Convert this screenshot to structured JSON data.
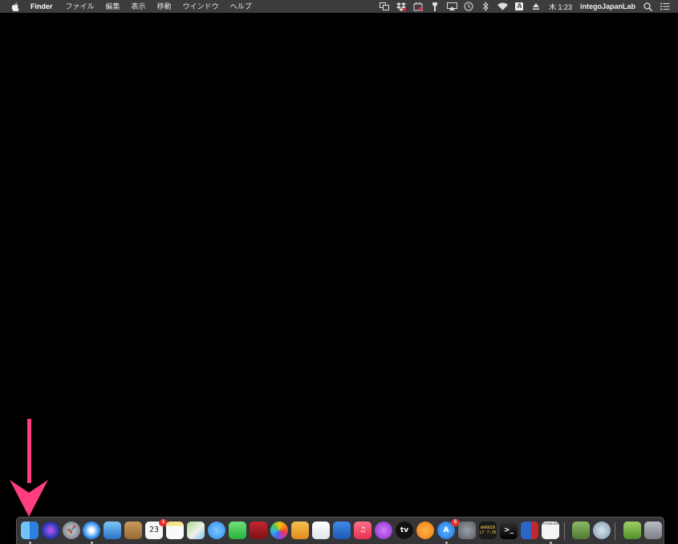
{
  "menubar": {
    "app_name": "Finder",
    "menus": [
      "ファイル",
      "編集",
      "表示",
      "移動",
      "ウインドウ",
      "ヘルプ"
    ],
    "status_icons": [
      "screen-mirroring-icon",
      "dropbox-icon",
      "intego-icon",
      "flashlight-icon",
      "airplay-icon",
      "time-machine-icon",
      "bluetooth-icon",
      "wifi-icon",
      "input-source-icon",
      "eject-icon"
    ],
    "input_source_label": "A",
    "clock": "木 1:23",
    "user": "integoJapanLab",
    "right_icons": [
      "spotlight-icon",
      "notification-center-icon"
    ]
  },
  "annotation": {
    "arrow_color": "#ff3d7f",
    "points_to": "finder"
  },
  "dock": {
    "items": [
      {
        "name": "finder-icon",
        "running": true
      },
      {
        "name": "siri-icon",
        "running": false
      },
      {
        "name": "launchpad-icon",
        "running": false
      },
      {
        "name": "safari-icon",
        "running": true
      },
      {
        "name": "mail-icon",
        "running": false
      },
      {
        "name": "contacts-icon",
        "running": false
      },
      {
        "name": "calendar-icon",
        "running": false,
        "label": "23",
        "badge": "1"
      },
      {
        "name": "notes-icon",
        "running": false
      },
      {
        "name": "maps-icon",
        "running": false
      },
      {
        "name": "messages-icon",
        "running": false
      },
      {
        "name": "facetime-icon",
        "running": false
      },
      {
        "name": "photo-booth-icon",
        "running": false
      },
      {
        "name": "photos-icon",
        "running": false
      },
      {
        "name": "pages-icon",
        "running": false
      },
      {
        "name": "numbers-icon",
        "running": false
      },
      {
        "name": "keynote-icon",
        "running": false
      },
      {
        "name": "music-icon",
        "running": false
      },
      {
        "name": "podcasts-icon",
        "running": false
      },
      {
        "name": "apple-tv-icon",
        "running": false
      },
      {
        "name": "books-icon",
        "running": false
      },
      {
        "name": "app-store-icon",
        "running": true,
        "badge": "5"
      },
      {
        "name": "system-preferences-icon",
        "running": false
      },
      {
        "name": "console-icon",
        "running": false,
        "label": "WARNIN\nLY 7:36"
      },
      {
        "name": "terminal-icon",
        "running": false
      },
      {
        "name": "preview-icon",
        "running": false
      },
      {
        "name": "screenshot-icon",
        "running": true,
        "label": "Screenshot"
      },
      {
        "name": "downloads-stack-icon",
        "running": false
      },
      {
        "name": "wifi-utility-icon",
        "running": false
      },
      {
        "name": "image-folder-icon",
        "running": false
      },
      {
        "name": "trash-icon",
        "running": false
      }
    ]
  },
  "colors": {
    "menubar_bg": "#3c3c3e",
    "desktop_bg": "#000000",
    "dock_bg": "#3a3a3c",
    "arrow": "#ff3d7f"
  }
}
